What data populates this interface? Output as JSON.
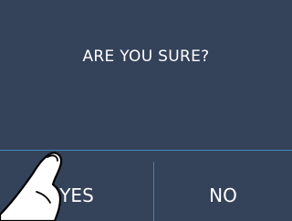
{
  "dialog": {
    "question": "ARE YOU SURE?",
    "yes_label": "YES",
    "no_label": "NO"
  },
  "colors": {
    "background": "#34425a",
    "divider": "#3f86b6",
    "text": "#ffffff"
  },
  "icons": {
    "pointer": "pointing-hand-icon"
  }
}
